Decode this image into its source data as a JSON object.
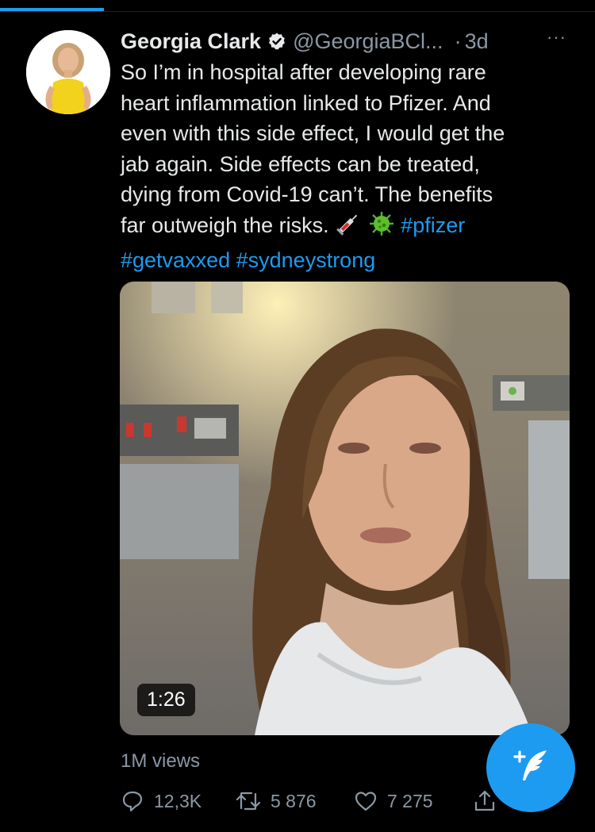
{
  "tweet": {
    "author_name": "Georgia Clark",
    "handle": "@GeorgiaBCl...",
    "separator": "·",
    "time": "3d",
    "more_label": "···",
    "text_lines": [
      "So I’m in hospital after developing rare",
      "heart inflammation linked to Pfizer. And",
      "even with this side effect, I would get the",
      "jab again. Side effects can be treated,",
      "dying from Covid-19 can’t. The benefits",
      "far outweigh the risks."
    ],
    "hashtags": [
      "#pfizer",
      "#getvaxxed",
      "#sydneystrong"
    ],
    "emojis": [
      "syringe-emoji",
      "microbe-emoji"
    ],
    "media": {
      "duration": "1:26"
    },
    "views": "1M views",
    "actions": {
      "replies": "12,3K",
      "retweets": "5 876",
      "likes": "7 275"
    }
  },
  "colors": {
    "background": "#000000",
    "accent": "#1d9bf0",
    "text": "#e7e9ea",
    "muted": "#8b98a5"
  },
  "icons": [
    "verified-icon",
    "more-icon",
    "reply-icon",
    "retweet-icon",
    "like-icon",
    "share-icon",
    "compose-tweet-icon"
  ]
}
